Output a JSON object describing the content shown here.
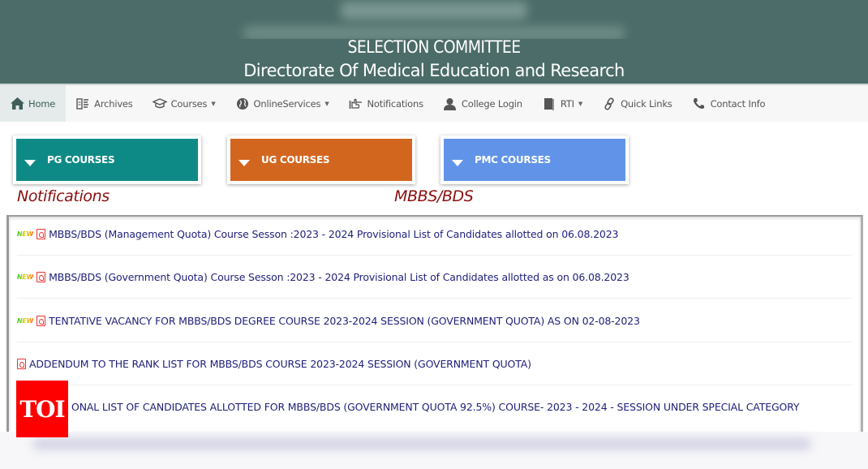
{
  "header": {
    "title": "SELECTION COMMITTEE",
    "subtitle": "Directorate Of Medical Education and Research",
    "background_color": "#4b6c68"
  },
  "navbar": {
    "items": [
      {
        "label": "Home",
        "icon": "home-icon",
        "active": true,
        "dropdown": false
      },
      {
        "label": "Archives",
        "icon": "archive-icon",
        "active": false,
        "dropdown": false
      },
      {
        "label": "Courses",
        "icon": "graduation-cap-icon",
        "active": false,
        "dropdown": true
      },
      {
        "label": "OnlineServices",
        "icon": "globe-icon",
        "active": false,
        "dropdown": true
      },
      {
        "label": "Notifications",
        "icon": "hand-pointer-icon",
        "active": false,
        "dropdown": false
      },
      {
        "label": "College Login",
        "icon": "user-icon",
        "active": false,
        "dropdown": false
      },
      {
        "label": "RTI",
        "icon": "book-icon",
        "active": false,
        "dropdown": true
      },
      {
        "label": "Quick Links",
        "icon": "link-icon",
        "active": false,
        "dropdown": false
      },
      {
        "label": "Contact Info",
        "icon": "phone-icon",
        "active": false,
        "dropdown": false
      }
    ],
    "dropdown_caret": "▼"
  },
  "course_buttons": [
    {
      "label": "PG COURSES",
      "color": "#0e8a86"
    },
    {
      "label": "UG COURSES",
      "color": "#d3661f"
    },
    {
      "label": "PMC COURSES",
      "color": "#6194e8"
    }
  ],
  "sections": {
    "notifications_title": "Notifications",
    "category_title": "MBBS/BDS",
    "title_color": "#8b0e0e"
  },
  "notifications": [
    {
      "is_new": true,
      "new_label": "NEW",
      "icon": "pdf-icon",
      "text": "MBBS/BDS (Management Quota) Course Sesson :2023 - 2024 Provisional List of Candidates allotted on 06.08.2023"
    },
    {
      "is_new": true,
      "new_label": "NEW",
      "icon": "pdf-icon",
      "text": "MBBS/BDS (Government Quota) Course Sesson :2023 - 2024 Provisional List of Candidates allotted as on 06.08.2023"
    },
    {
      "is_new": true,
      "new_label": "NEW",
      "icon": "pdf-icon",
      "text": "TENTATIVE VACANCY FOR MBBS/BDS DEGREE COURSE 2023-2024 SESSION (GOVERNMENT QUOTA) AS ON 02-08-2023"
    },
    {
      "is_new": false,
      "new_label": "",
      "icon": "pdf-icon",
      "text": "ADDENDUM TO THE RANK LIST FOR MBBS/BDS COURSE 2023-2024 SESSION (GOVERNMENT QUOTA)"
    },
    {
      "is_new": false,
      "new_label": "",
      "icon": "pdf-icon",
      "text": "ONAL LIST OF CANDIDATES ALLOTTED FOR MBBS/BDS (GOVERNMENT QUOTA 92.5%) COURSE- 2023 - 2024 - SESSION UNDER SPECIAL CATEGORY"
    }
  ],
  "watermark": {
    "label": "TOI",
    "color": "#ff0000"
  }
}
